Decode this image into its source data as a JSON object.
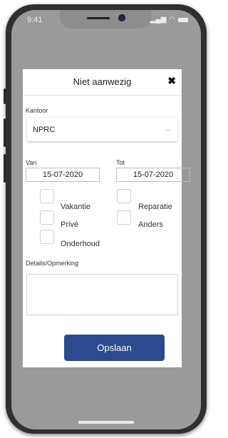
{
  "status_bar": {
    "time": "9:41"
  },
  "modal": {
    "title": "Niet aanwezig",
    "close_glyph": "✖",
    "office": {
      "label": "Kantoor",
      "value": "NPRC"
    },
    "from": {
      "label": "Van",
      "value": "15-07-2020"
    },
    "to": {
      "label": "Tot",
      "value": "15-07-2020"
    },
    "options": {
      "vakantie": "Vakantie",
      "reparatie": "Reparatie",
      "prive": "Privé",
      "anders": "Anders",
      "onderhoud": "Onderhoud"
    },
    "details": {
      "label": "Details/Opmerking",
      "value": ""
    },
    "save_label": "Opslaan"
  },
  "colors": {
    "primary": "#2d4a8f",
    "overlay": "#9a9a9a"
  },
  "icons": [
    "close-icon",
    "chevron-down-icon",
    "signal-icon",
    "wifi-icon",
    "battery-icon"
  ]
}
